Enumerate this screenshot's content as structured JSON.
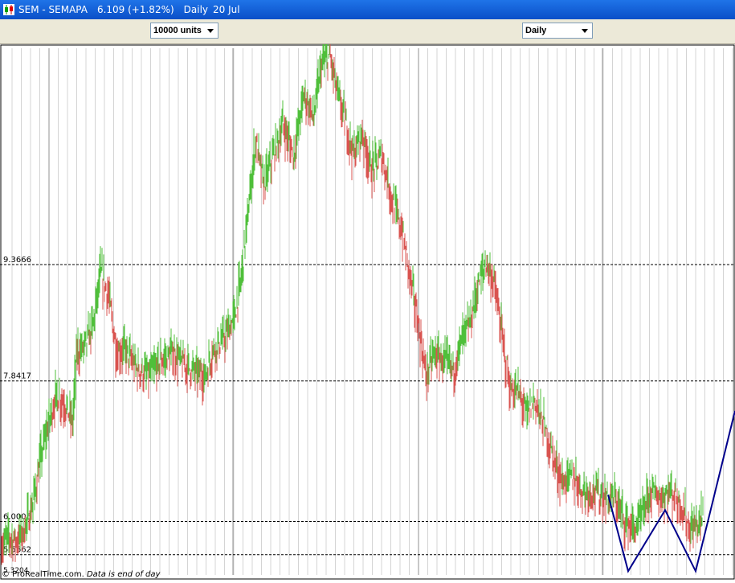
{
  "window": {
    "symbol": "SEM - SEMAPA",
    "price": "6.109 (+1.82%)",
    "period": "Daily",
    "date": "20 Jul"
  },
  "toolbar": {
    "units_value": "10000 units",
    "period_value": "Daily"
  },
  "footer": {
    "copyright": "© ProRealTime.com",
    "note": "Data is end of day"
  },
  "colors": {
    "up_candle": "#4fbf3a",
    "down_candle": "#d9534f",
    "pattern_line": "#00008b",
    "titlebar": "#0a4fc8"
  },
  "chart_data": {
    "type": "candlestick",
    "title": "",
    "xlabel": "",
    "ylabel": "",
    "ylim": [
      5.3,
      12.2
    ],
    "grid": "vertical",
    "levels": [
      {
        "value": 9.3666,
        "label": "9.3666"
      },
      {
        "value": 7.8417,
        "label": "7.8417"
      },
      {
        "value": 6.0006,
        "label": "6.0006"
      },
      {
        "value": 5.5662,
        "label": "5.5662"
      }
    ],
    "bottom_value": {
      "value": 5.3204,
      "label": "5.3204"
    },
    "price_path": [
      [
        0,
        5.65
      ],
      [
        10,
        5.8
      ],
      [
        20,
        5.75
      ],
      [
        30,
        5.9
      ],
      [
        40,
        6.2
      ],
      [
        50,
        6.8
      ],
      [
        60,
        7.3
      ],
      [
        70,
        7.65
      ],
      [
        80,
        7.55
      ],
      [
        90,
        7.3
      ],
      [
        95,
        8.2
      ],
      [
        105,
        8.3
      ],
      [
        115,
        8.55
      ],
      [
        125,
        9.25
      ],
      [
        135,
        8.95
      ],
      [
        145,
        8.2
      ],
      [
        155,
        8.25
      ],
      [
        170,
        8.0
      ],
      [
        185,
        7.9
      ],
      [
        200,
        8.1
      ],
      [
        215,
        8.2
      ],
      [
        230,
        8.05
      ],
      [
        245,
        7.95
      ],
      [
        255,
        7.9
      ],
      [
        265,
        8.25
      ],
      [
        280,
        8.4
      ],
      [
        292,
        8.7
      ],
      [
        300,
        9.2
      ],
      [
        310,
        10.2
      ],
      [
        318,
        11.0
      ],
      [
        328,
        10.4
      ],
      [
        340,
        10.8
      ],
      [
        352,
        11.2
      ],
      [
        365,
        10.8
      ],
      [
        378,
        11.6
      ],
      [
        390,
        11.3
      ],
      [
        400,
        12.0
      ],
      [
        410,
        12.1
      ],
      [
        420,
        11.6
      ],
      [
        430,
        11.2
      ],
      [
        440,
        10.8
      ],
      [
        450,
        11.1
      ],
      [
        462,
        10.6
      ],
      [
        475,
        10.8
      ],
      [
        488,
        10.2
      ],
      [
        500,
        9.8
      ],
      [
        512,
        9.1
      ],
      [
        520,
        8.6
      ],
      [
        530,
        7.9
      ],
      [
        540,
        8.2
      ],
      [
        552,
        8.1
      ],
      [
        565,
        8.0
      ],
      [
        575,
        8.4
      ],
      [
        585,
        8.6
      ],
      [
        595,
        9.1
      ],
      [
        605,
        9.4
      ],
      [
        615,
        9.1
      ],
      [
        625,
        8.4
      ],
      [
        635,
        7.7
      ],
      [
        645,
        7.7
      ],
      [
        655,
        7.4
      ],
      [
        665,
        7.6
      ],
      [
        675,
        7.3
      ],
      [
        690,
        6.8
      ],
      [
        700,
        6.5
      ],
      [
        712,
        6.6
      ],
      [
        725,
        6.4
      ],
      [
        740,
        6.4
      ],
      [
        752,
        6.3
      ],
      [
        765,
        6.3
      ],
      [
        778,
        6.0
      ],
      [
        790,
        5.9
      ],
      [
        800,
        6.1
      ],
      [
        810,
        6.4
      ],
      [
        822,
        6.3
      ],
      [
        835,
        6.4
      ],
      [
        848,
        6.2
      ],
      [
        858,
        5.9
      ],
      [
        868,
        5.95
      ],
      [
        875,
        6.1
      ]
    ],
    "pattern_points": [
      [
        757,
        6.35
      ],
      [
        782,
        5.35
      ],
      [
        828,
        6.15
      ],
      [
        866,
        5.35
      ],
      [
        915,
        7.45
      ]
    ]
  }
}
